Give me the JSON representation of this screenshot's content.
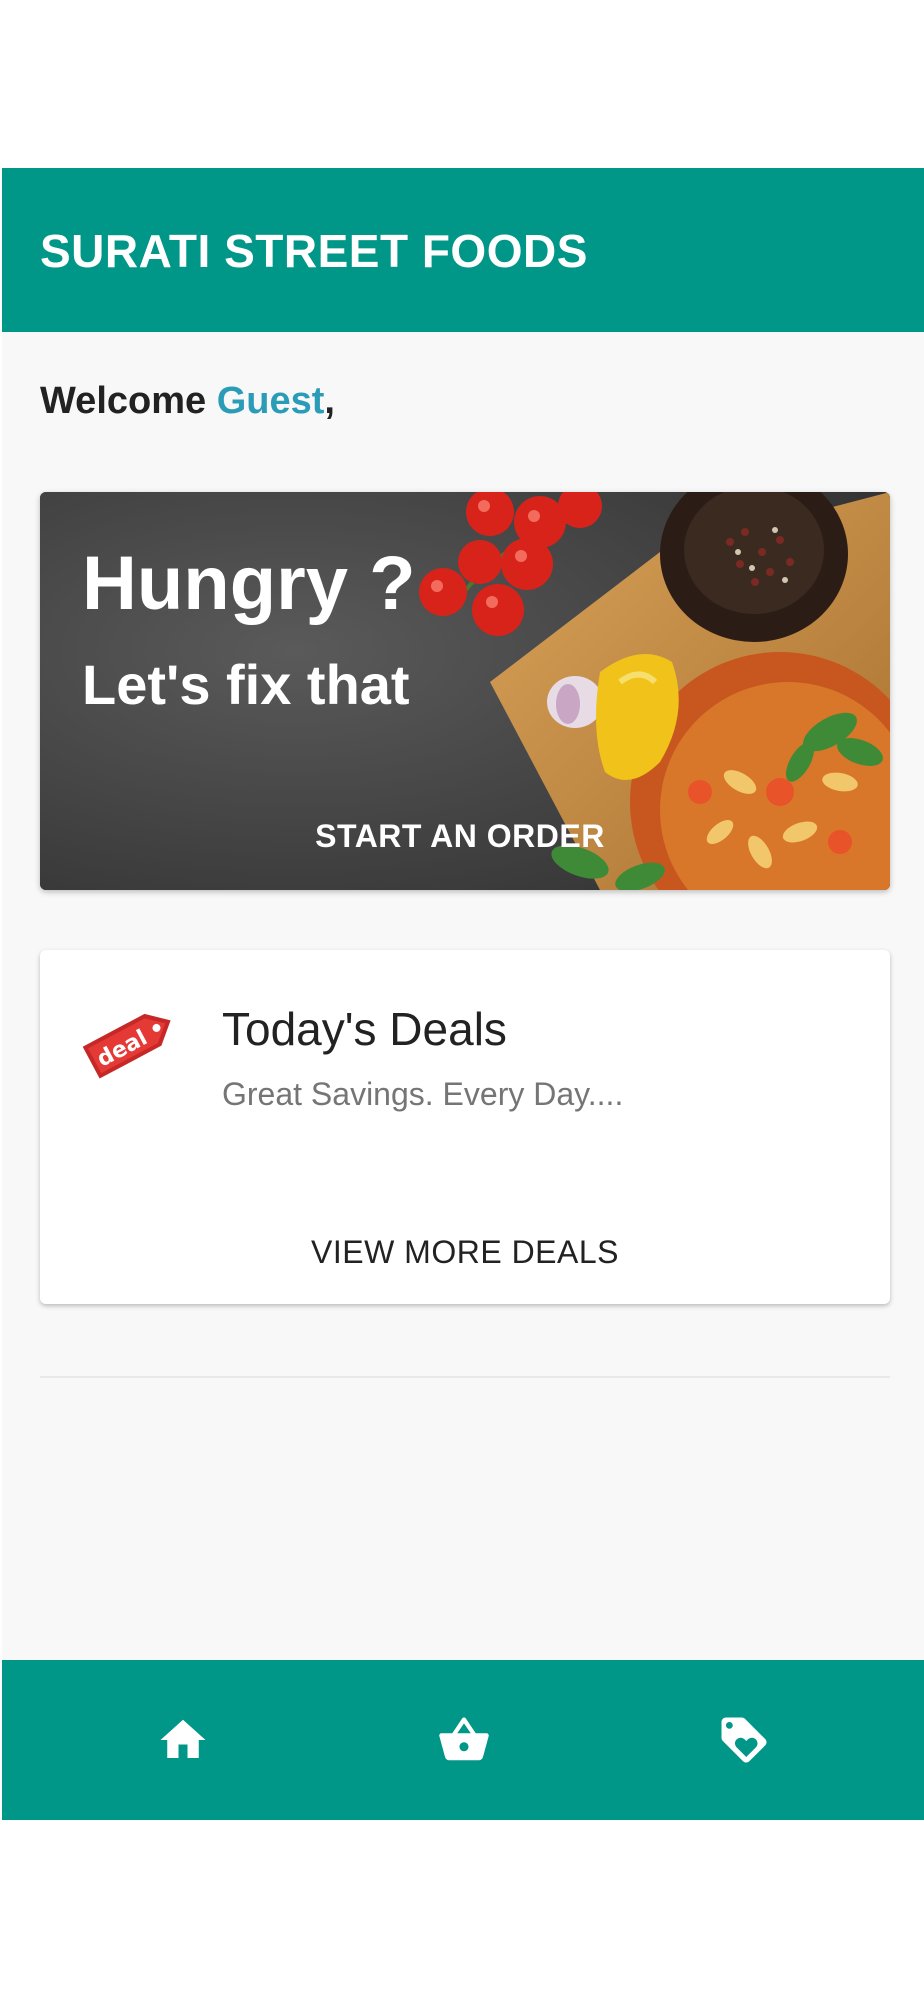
{
  "app": {
    "title": "SURATI STREET FOODS",
    "brand_color": "#009688"
  },
  "welcome": {
    "prefix": "Welcome ",
    "name": "Guest",
    "suffix": ",",
    "name_color": "#2b9cb8"
  },
  "hero": {
    "headline": "Hungry ?",
    "subheadline": "Let's fix that",
    "cta_label": "START AN ORDER"
  },
  "deals": {
    "icon_text": "deal",
    "title": "Today's Deals",
    "subtitle": "Great Savings. Every Day....",
    "cta_label": "VIEW MORE DEALS"
  },
  "bottom_nav": {
    "items": [
      {
        "icon": "home-icon"
      },
      {
        "icon": "basket-icon"
      },
      {
        "icon": "tag-heart-icon"
      }
    ]
  }
}
